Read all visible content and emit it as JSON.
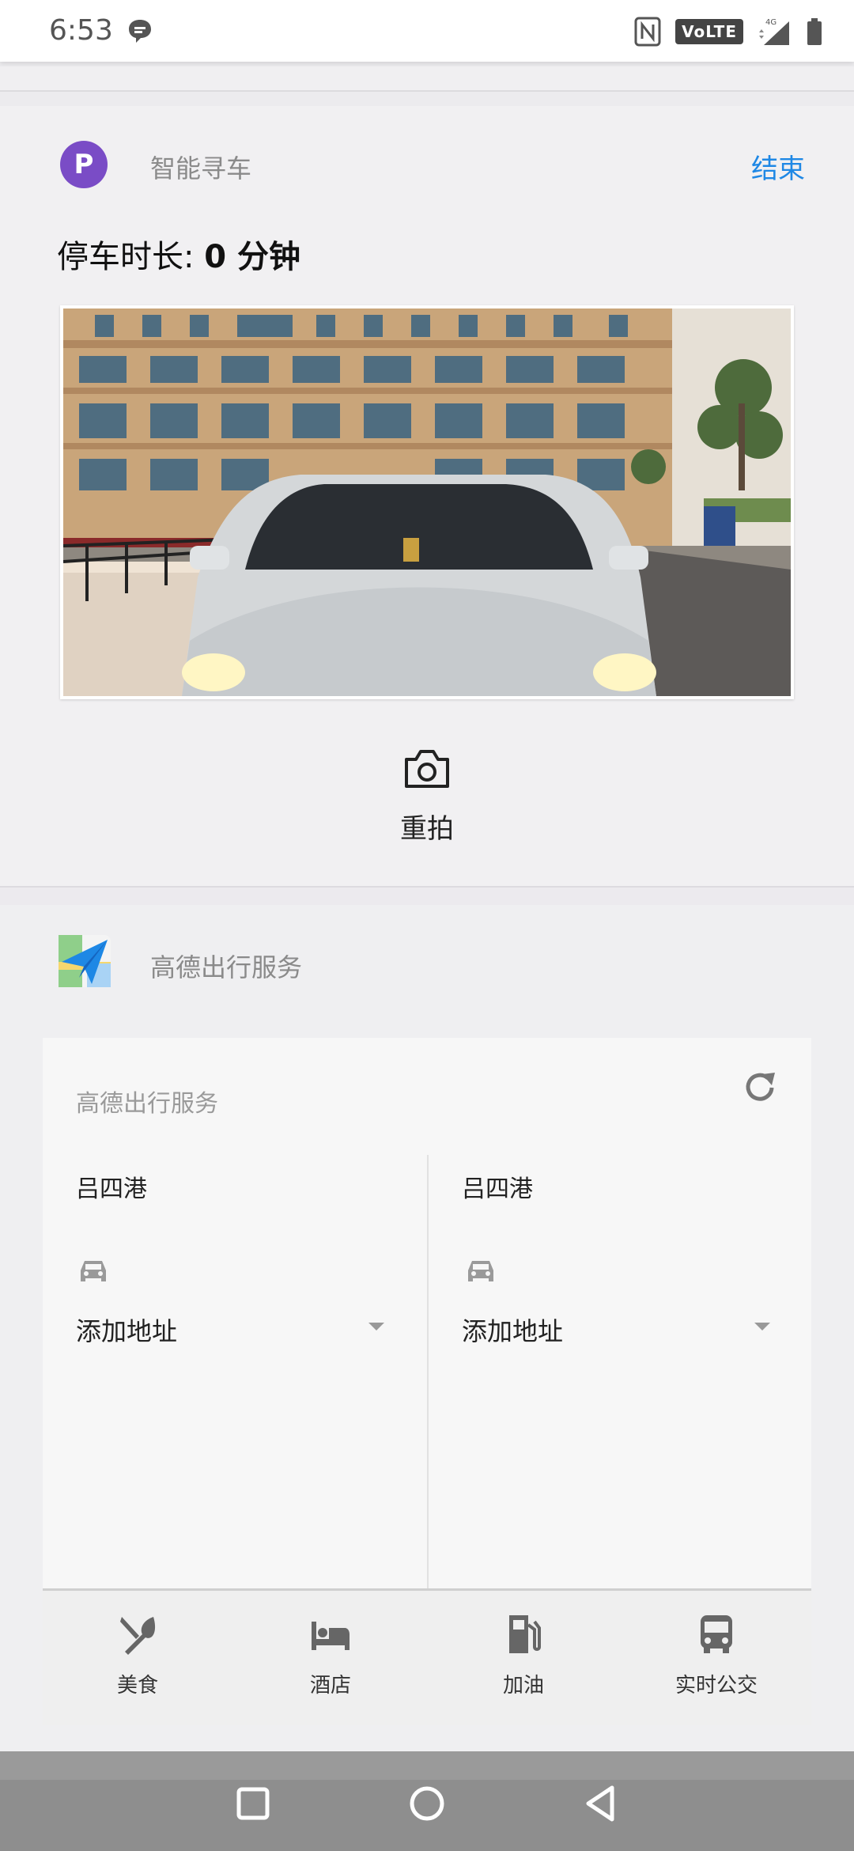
{
  "status_bar": {
    "time": "6:53",
    "volte": "VoLTE",
    "network": "4G"
  },
  "parking": {
    "avatar_letter": "P",
    "title": "智能寻车",
    "end_label": "结束",
    "duration_label": "停车时长: ",
    "duration_value": "0 分钟",
    "retake_label": "重拍"
  },
  "service": {
    "header_title": "高德出行服务",
    "panel_title": "高德出行服务",
    "columns": [
      {
        "location": "吕四港",
        "address_label": "添加地址"
      },
      {
        "location": "吕四港",
        "address_label": "添加地址"
      }
    ],
    "shortcuts": [
      {
        "label": "美食",
        "icon": "food-icon"
      },
      {
        "label": "酒店",
        "icon": "hotel-icon"
      },
      {
        "label": "加油",
        "icon": "gas-station-icon"
      },
      {
        "label": "实时公交",
        "icon": "bus-icon"
      }
    ]
  },
  "colors": {
    "accent": "#1f88e5",
    "avatar": "#7a4cc6",
    "navbar": "#8e8e8e"
  }
}
